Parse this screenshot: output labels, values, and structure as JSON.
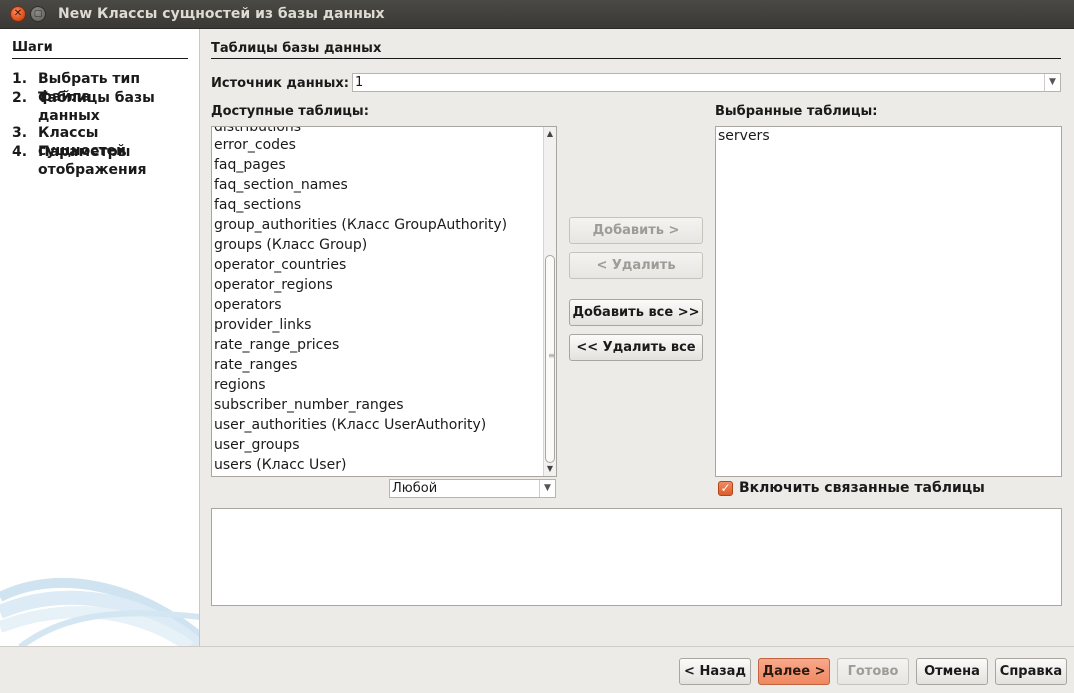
{
  "window": {
    "title": "New Классы сущностей из базы данных",
    "close_icon": "close-icon",
    "minimize_icon": "minimize-icon"
  },
  "steps": {
    "title": "Шаги",
    "items": [
      {
        "num": "1.",
        "label": "Выбрать тип файла"
      },
      {
        "num": "2.",
        "label": "Таблицы базы данных"
      },
      {
        "num": "3.",
        "label": "Классы сущностей"
      },
      {
        "num": "4.",
        "label": "Параметры отображения"
      }
    ]
  },
  "main": {
    "section_title": "Таблицы базы данных",
    "datasource_label": "Источник данных:",
    "datasource_value": "1",
    "available_label": "Доступные таблицы:",
    "available_items": [
      "distributions",
      "error_codes",
      "faq_pages",
      "faq_section_names",
      "faq_sections",
      "group_authorities (Класс GroupAuthority)",
      "groups (Класс Group)",
      "operator_countries",
      "operator_regions",
      "operators",
      "provider_links",
      "rate_range_prices",
      "rate_ranges",
      "regions",
      "subscriber_number_ranges",
      "user_authorities (Класс UserAuthority)",
      "user_groups",
      "users (Класс User)"
    ],
    "filter_value": "Любой",
    "selected_label": "Выбранные таблицы:",
    "selected_items": [
      "servers"
    ],
    "buttons": {
      "add": "Добавить >",
      "remove": "< Удалить",
      "add_all": "Добавить все >>",
      "remove_all": "<< Удалить все"
    },
    "include_related_label": "Включить связанные таблицы",
    "include_related_checked": true
  },
  "footer": {
    "back": "< Назад",
    "next": "Далее >",
    "finish": "Готово",
    "cancel": "Отмена",
    "help": "Справка"
  },
  "colors": {
    "accent": "#ef8860",
    "titlebar": "#3c3b37",
    "background": "#ecebe7"
  }
}
